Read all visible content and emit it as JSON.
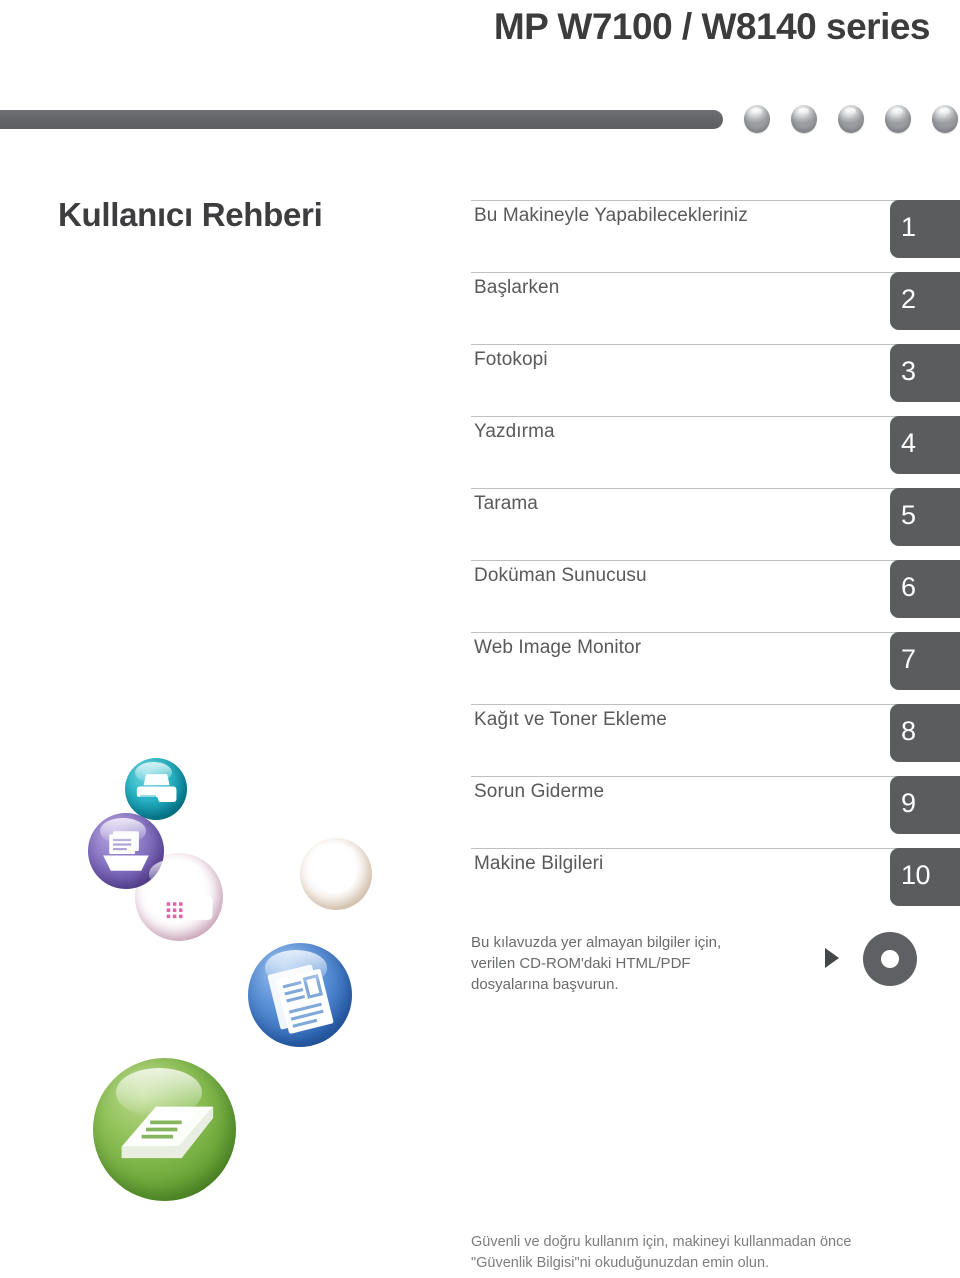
{
  "header": {
    "product_title": "MP W7100 / W8140 series",
    "bar_color": "#64666a",
    "dots": [
      "dot-1",
      "dot-2",
      "dot-3",
      "dot-4",
      "dot-5"
    ]
  },
  "guide": {
    "title": "Kullanıcı Rehberi"
  },
  "toc": {
    "items": [
      {
        "label": "Bu Makineyle Yapabilecekleriniz",
        "number": "1"
      },
      {
        "label": "Başlarken",
        "number": "2"
      },
      {
        "label": "Fotokopi",
        "number": "3"
      },
      {
        "label": "Yazdırma",
        "number": "4"
      },
      {
        "label": "Tarama",
        "number": "5"
      },
      {
        "label": "Doküman Sunucusu",
        "number": "6"
      },
      {
        "label": "Web Image Monitor",
        "number": "7"
      },
      {
        "label": "Kağıt ve Toner Ekleme",
        "number": "8"
      },
      {
        "label": "Sorun Giderme",
        "number": "9"
      },
      {
        "label": "Makine Bilgileri",
        "number": "10"
      }
    ],
    "tab_color": "#5b5c5e",
    "text_color": "#58595b"
  },
  "cd_note": {
    "line1": "Bu kılavuzda yer almayan bilgiler için,",
    "line2": "verilen CD-ROM'daki HTML/PDF",
    "line3": "dosyalarına başvurun.",
    "arrow_icon": "play-arrow-icon",
    "disc_icon": "cd-rom-disc-icon"
  },
  "footer": {
    "line1": "Güvenli ve doğru kullanım için, makineyi kullanmadan önce",
    "line2": "\"Güvenlik Bilgisi\"ni okuduğunuzdan emin olun."
  },
  "decorations": {
    "orbs": [
      {
        "name": "printer-orb-icon",
        "color": "#12a0b4"
      },
      {
        "name": "copier-orb-icon",
        "color": "#7d69bd"
      },
      {
        "name": "fax-orb-icon",
        "color": "#d63a97"
      },
      {
        "name": "web-globe-orb-icon",
        "color": "#f18a26"
      },
      {
        "name": "document-orb-icon",
        "color": "#3d7bc8"
      },
      {
        "name": "scanner-orb-icon",
        "color": "#76b243"
      }
    ]
  }
}
